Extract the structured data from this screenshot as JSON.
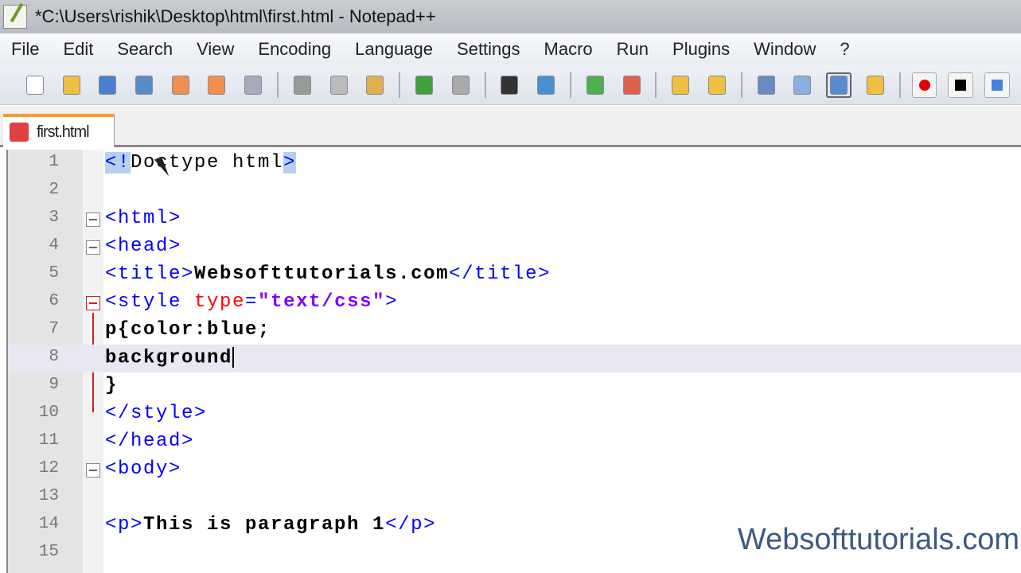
{
  "window": {
    "title": "*C:\\Users\\rishik\\Desktop\\html\\first.html - Notepad++"
  },
  "menu": [
    "File",
    "Edit",
    "Search",
    "View",
    "Encoding",
    "Language",
    "Settings",
    "Macro",
    "Run",
    "Plugins",
    "Window",
    "?"
  ],
  "toolbar": [
    "new-file-icon",
    "open-file-icon",
    "save-icon",
    "save-all-icon",
    "close-icon",
    "close-all-icon",
    "print-icon",
    "|",
    "cut-icon",
    "copy-icon",
    "paste-icon",
    "|",
    "undo-icon",
    "redo-icon",
    "|",
    "find-icon",
    "replace-icon",
    "|",
    "zoom-in-icon",
    "zoom-out-icon",
    "|",
    "sync-vertical-icon",
    "sync-horizontal-icon",
    "|",
    "word-wrap-icon",
    "show-all-chars-icon",
    "indent-guide-icon",
    "user-language-icon",
    "|",
    "record-macro-icon",
    "stop-macro-icon",
    "play-macro-icon"
  ],
  "tab": {
    "label": "first.html"
  },
  "lines": [
    {
      "n": "1",
      "code": "<!Doctype html>"
    },
    {
      "n": "2",
      "code": ""
    },
    {
      "n": "3",
      "code": "<html>"
    },
    {
      "n": "4",
      "code": "<head>"
    },
    {
      "n": "5",
      "code": "<title>Websofttutorials.com</title>"
    },
    {
      "n": "6",
      "code": "<style type=\"text/css\">"
    },
    {
      "n": "7",
      "code": "p{color:blue;"
    },
    {
      "n": "8",
      "code": "background"
    },
    {
      "n": "9",
      "code": "}"
    },
    {
      "n": "10",
      "code": "</style>"
    },
    {
      "n": "11",
      "code": "</head>"
    },
    {
      "n": "12",
      "code": "<body>"
    },
    {
      "n": "13",
      "code": ""
    },
    {
      "n": "14",
      "code": "<p>This is paragraph 1</p>"
    },
    {
      "n": "15",
      "code": ""
    }
  ],
  "watermark": "Websofttutorials.com"
}
